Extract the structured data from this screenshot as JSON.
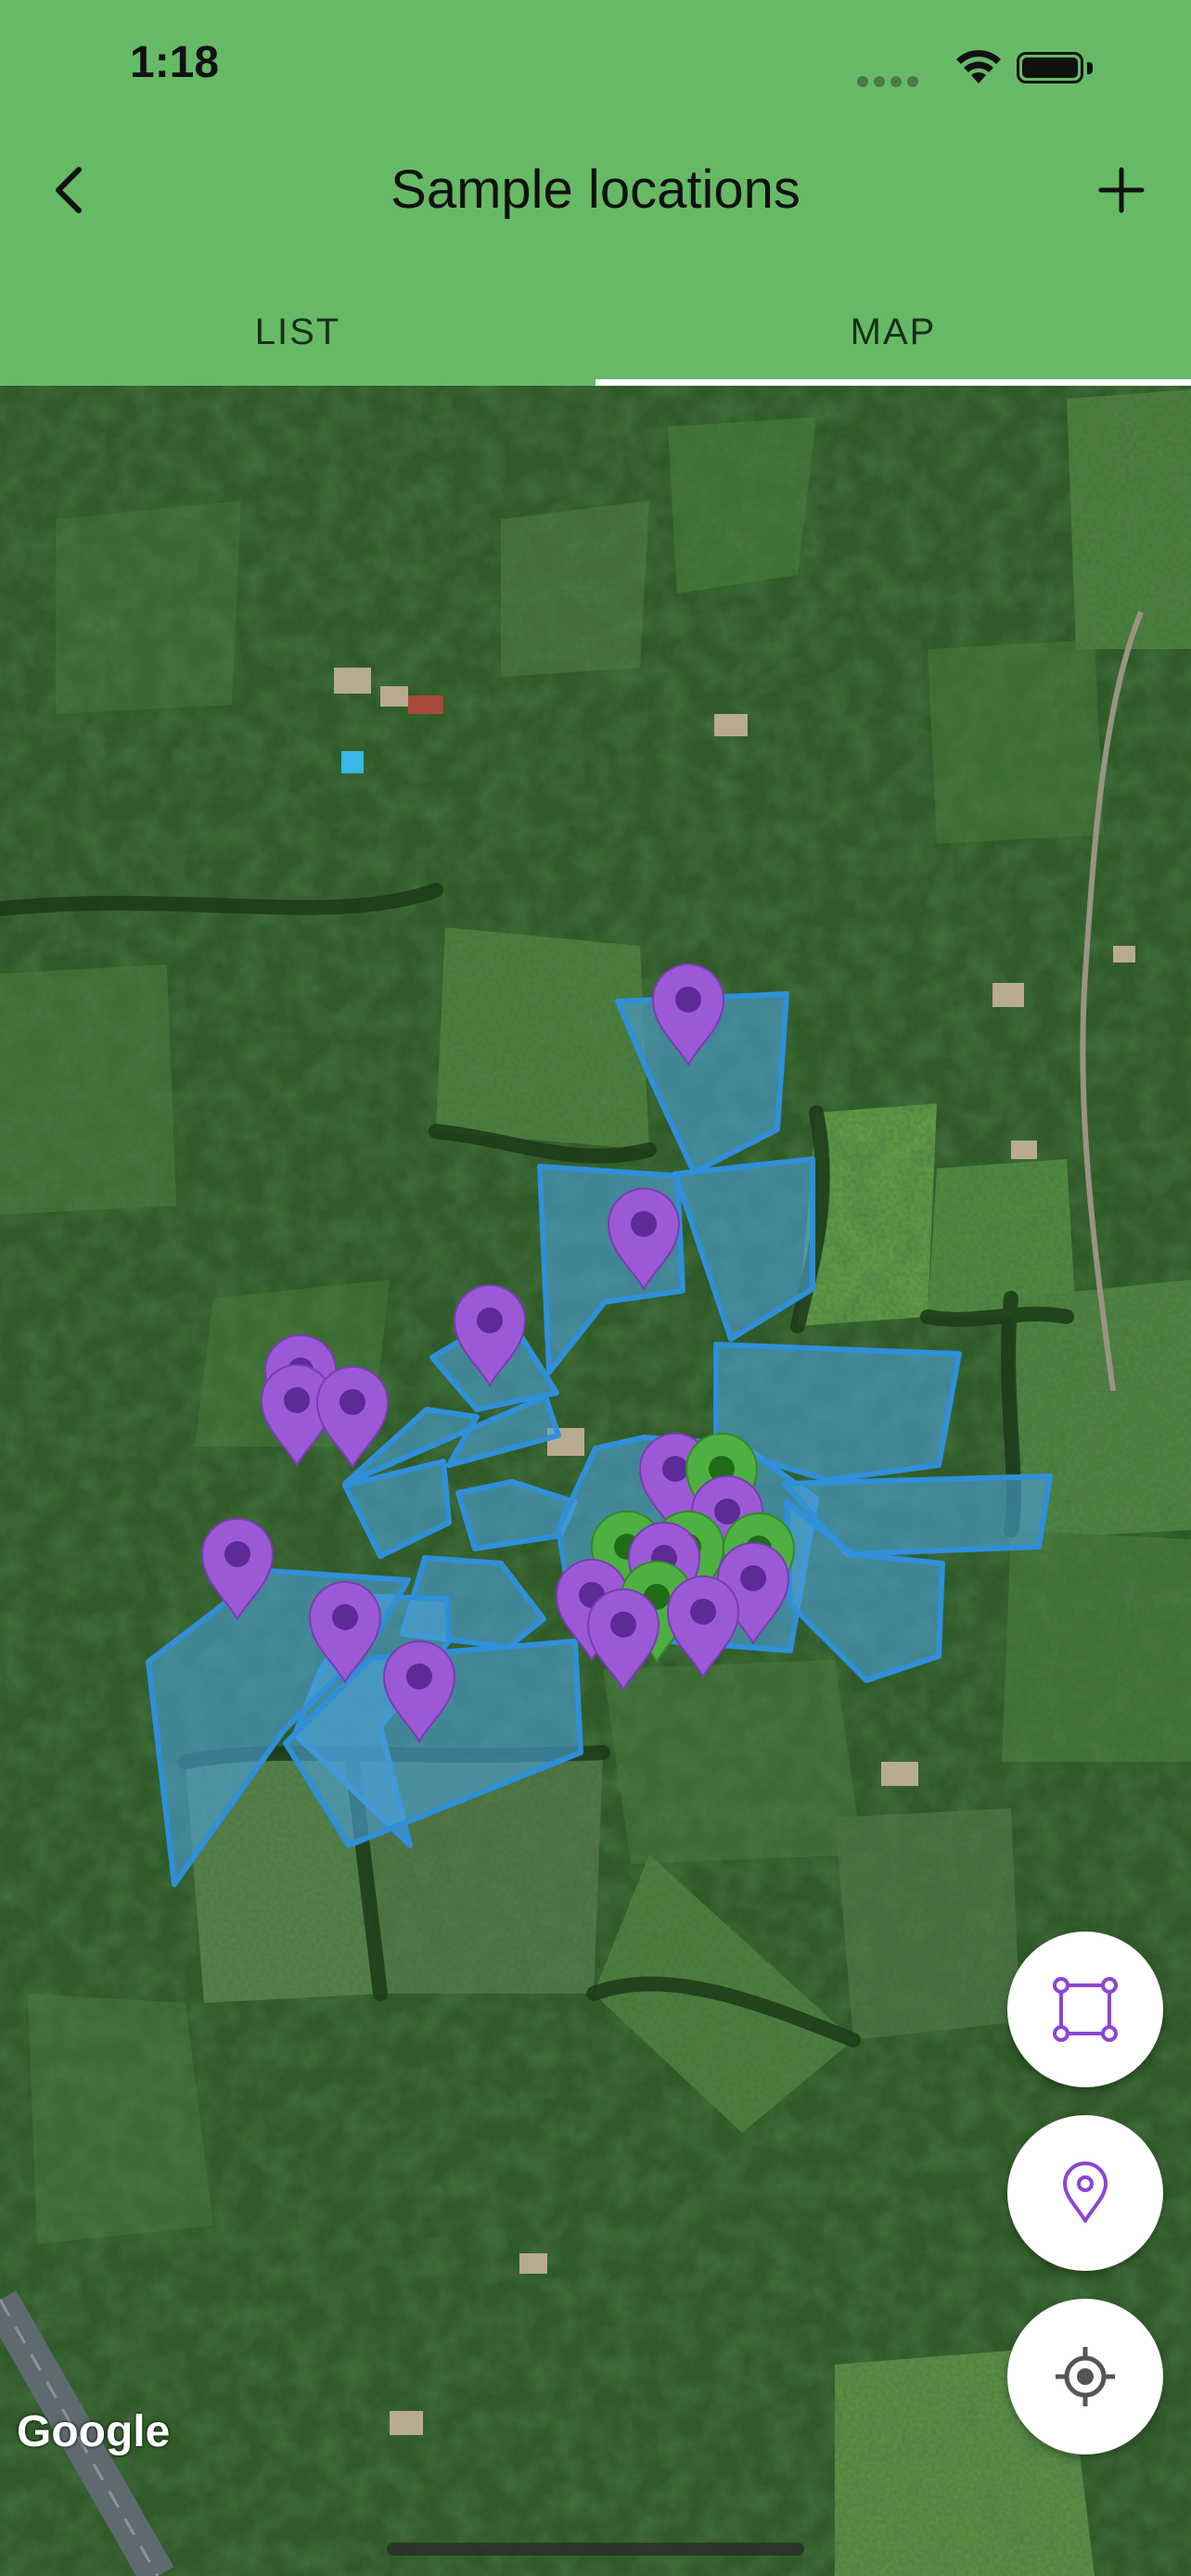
{
  "status_bar": {
    "time": "1:18"
  },
  "header": {
    "title": "Sample locations",
    "back_icon": "chevron-left-icon",
    "add_icon": "plus-icon"
  },
  "tabs": [
    {
      "label": "LIST",
      "active": false
    },
    {
      "label": "MAP",
      "active": true
    }
  ],
  "map": {
    "attribution": "Google",
    "map_type": "satellite",
    "colors": {
      "field_fill": "#4a9fd6",
      "field_stroke": "#2f8fd8",
      "pin_purple": "#9b59d6",
      "pin_green": "#4db040",
      "header_green": "#67ba65"
    },
    "pin_counts": {
      "purple": 17,
      "green": 5
    }
  },
  "controls": {
    "draw_area_icon": "polygon-draw-icon",
    "add_pin_icon": "map-pin-icon",
    "my_location_icon": "crosshair-location-icon"
  }
}
